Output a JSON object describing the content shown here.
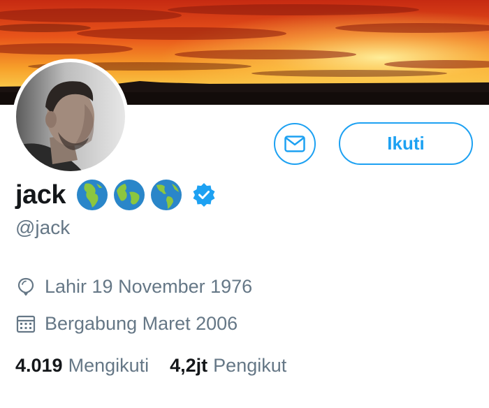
{
  "profile": {
    "name": "jack",
    "handle": "@jack",
    "globe_icons": [
      "globe-africa-icon",
      "globe-europe-africa-icon",
      "globe-americas-icon"
    ],
    "verified_icon": "verified-badge-icon"
  },
  "actions": {
    "message_icon": "envelope-icon",
    "follow_label": "Ikuti"
  },
  "meta": {
    "birth_label": "Lahir 19 November 1976",
    "joined_label": "Bergabung Maret 2006"
  },
  "stats": {
    "following_count": "4.019",
    "following_label": "Mengikuti",
    "followers_count": "4,2jt",
    "followers_label": "Pengikut"
  },
  "colors": {
    "accent": "#1da1f2",
    "text_primary": "#14171a",
    "text_secondary": "#657786"
  }
}
